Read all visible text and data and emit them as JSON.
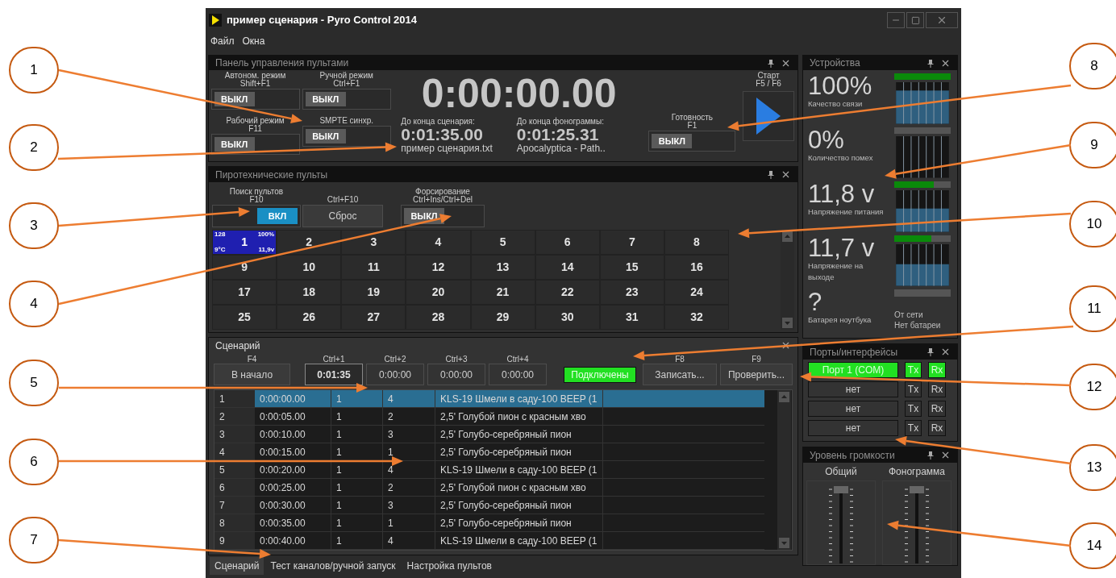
{
  "window": {
    "title": "пример сценария - Pyro Control 2014"
  },
  "menu": [
    "Файл",
    "Окна"
  ],
  "control_panel": {
    "title": "Панель управления пультами",
    "toggles": [
      {
        "label": "Автоном. режим",
        "hotkey": "Shift+F1",
        "value": "ВЫКЛ",
        "on": false
      },
      {
        "label": "Ручной режим",
        "hotkey": "Ctrl+F1",
        "value": "ВЫКЛ",
        "on": false
      },
      {
        "label": "Рабочий режим",
        "hotkey": "F11",
        "value": "ВЫКЛ",
        "on": false
      },
      {
        "label": "SMPTE синхр.",
        "value": "ВЫКЛ",
        "on": false
      }
    ],
    "main_time": "0:00:00.00",
    "remaining": [
      {
        "label": "До конца сценария:",
        "time": "0:01:35.00",
        "file": "пример сценария.txt"
      },
      {
        "label": "До конца фонограммы:",
        "time": "0:01:25.31",
        "file": "Apocalyptica - Path.."
      }
    ],
    "ready": {
      "label": "Готовность",
      "hotkey": "F1",
      "value": "ВЫКЛ",
      "on": false
    },
    "start": {
      "label": "Старт",
      "hotkey": "F5 / F6"
    }
  },
  "pyro_panel": {
    "title": "Пиротехнические пульты",
    "search": {
      "label": "Поиск пультов",
      "hotkey": "F10",
      "value": "ВКЛ",
      "on": true
    },
    "reset": {
      "hotkey": "Ctrl+F10",
      "label": "Сброс"
    },
    "force": {
      "label": "Форсирование",
      "hotkey": "Ctrl+Ins/Ctrl+Del",
      "value": "ВЫКЛ",
      "on": false
    },
    "consoles": [
      {
        "number": "1",
        "connected": true,
        "channels": "128",
        "link": "100%",
        "temperature": "9°C",
        "voltage": "11,9v"
      },
      {
        "number": "2",
        "connected": false
      },
      {
        "number": "3",
        "connected": false
      },
      {
        "number": "4",
        "connected": false
      },
      {
        "number": "5",
        "connected": false
      },
      {
        "number": "6",
        "connected": false
      },
      {
        "number": "7",
        "connected": false
      },
      {
        "number": "8",
        "connected": false
      },
      {
        "number": "9",
        "connected": false
      },
      {
        "number": "10",
        "connected": false
      },
      {
        "number": "11",
        "connected": false
      },
      {
        "number": "12",
        "connected": false
      },
      {
        "number": "13",
        "connected": false
      },
      {
        "number": "14",
        "connected": false
      },
      {
        "number": "15",
        "connected": false
      },
      {
        "number": "16",
        "connected": false
      },
      {
        "number": "17",
        "connected": false
      },
      {
        "number": "18",
        "connected": false
      },
      {
        "number": "19",
        "connected": false
      },
      {
        "number": "20",
        "connected": false
      },
      {
        "number": "21",
        "connected": false
      },
      {
        "number": "22",
        "connected": false
      },
      {
        "number": "23",
        "connected": false
      },
      {
        "number": "24",
        "connected": false
      },
      {
        "number": "25",
        "connected": false
      },
      {
        "number": "26",
        "connected": false
      },
      {
        "number": "27",
        "connected": false
      },
      {
        "number": "28",
        "connected": false
      },
      {
        "number": "29",
        "connected": false
      },
      {
        "number": "30",
        "connected": false
      },
      {
        "number": "31",
        "connected": false
      },
      {
        "number": "32",
        "connected": false
      }
    ]
  },
  "scenario": {
    "title": "Сценарий",
    "start_button": {
      "hotkey": "F4",
      "label": "В начало"
    },
    "markers": [
      {
        "hotkey": "Ctrl+1",
        "value": "0:01:35",
        "selected": true
      },
      {
        "hotkey": "Ctrl+2",
        "value": "0:00:00",
        "selected": false
      },
      {
        "hotkey": "Ctrl+3",
        "value": "0:00:00",
        "selected": false
      },
      {
        "hotkey": "Ctrl+4",
        "value": "0:00:00",
        "selected": false
      }
    ],
    "status": "Подключены",
    "record": {
      "hotkey": "F8",
      "label": "Записать..."
    },
    "check": {
      "hotkey": "F9",
      "label": "Проверить..."
    },
    "rows": [
      {
        "index": "1",
        "time": "0:00:00.00",
        "column_3": "1",
        "column_4": "4",
        "description": "KLS-19 Шмели в саду-100 BEEP (1",
        "selected": true
      },
      {
        "index": "2",
        "time": "0:00:05.00",
        "column_3": "1",
        "column_4": "2",
        "description": "2,5' Голубой пион с красным хво",
        "selected": false
      },
      {
        "index": "3",
        "time": "0:00:10.00",
        "column_3": "1",
        "column_4": "3",
        "description": "2,5' Голубо-серебряный  пион",
        "selected": false
      },
      {
        "index": "4",
        "time": "0:00:15.00",
        "column_3": "1",
        "column_4": "1",
        "description": "2,5' Голубо-серебряный  пион",
        "selected": false
      },
      {
        "index": "5",
        "time": "0:00:20.00",
        "column_3": "1",
        "column_4": "4",
        "description": "KLS-19 Шмели в саду-100 BEEP (1",
        "selected": false
      },
      {
        "index": "6",
        "time": "0:00:25.00",
        "column_3": "1",
        "column_4": "2",
        "description": "2,5' Голубой пион с красным хво",
        "selected": false
      },
      {
        "index": "7",
        "time": "0:00:30.00",
        "column_3": "1",
        "column_4": "3",
        "description": "2,5' Голубо-серебряный  пион",
        "selected": false
      },
      {
        "index": "8",
        "time": "0:00:35.00",
        "column_3": "1",
        "column_4": "1",
        "description": "2,5' Голубо-серебряный  пион",
        "selected": false
      },
      {
        "index": "9",
        "time": "0:00:40.00",
        "column_3": "1",
        "column_4": "4",
        "description": "KLS-19 Шмели в саду-100 BEEP (1",
        "selected": false
      }
    ]
  },
  "bottom_tabs": [
    {
      "label": "Сценарий",
      "selected": true
    },
    {
      "label": "Тест каналов/ручной запуск",
      "selected": false
    },
    {
      "label": "Настройка пультов",
      "selected": false
    }
  ],
  "devices": {
    "title": "Устройства",
    "metrics": [
      {
        "kind": "meter",
        "value": "100%",
        "label": "Качество связи",
        "level": 1
      },
      {
        "kind": "meter",
        "value": "0%",
        "label": "Количество помех",
        "level": 0
      },
      {
        "kind": "meter",
        "value": "11,8 v",
        "label": "Напряжение питания",
        "level": 0.7
      },
      {
        "kind": "meter",
        "value": "11,7 v",
        "label": "Напряжение на выходе",
        "level": 0.65
      },
      {
        "kind": "battery",
        "value": "?",
        "label": "Батарея ноутбука",
        "level": 0,
        "source": "От сети",
        "state": "Нет батареи"
      }
    ]
  },
  "ports": {
    "title": "Порты/интерфейсы",
    "items": [
      {
        "label": "Порт 1 (COM)",
        "tx": "Tx",
        "rx": "Rx",
        "active": true
      },
      {
        "label": "нет",
        "tx": "Tx",
        "rx": "Rx",
        "active": false
      },
      {
        "label": "нет",
        "tx": "Tx",
        "rx": "Rx",
        "active": false
      },
      {
        "label": "нет",
        "tx": "Tx",
        "rx": "Rx",
        "active": false
      }
    ]
  },
  "volume": {
    "title": "Уровень громкости",
    "sliders": [
      {
        "label": "Общий",
        "level": 1
      },
      {
        "label": "Фонограмма",
        "level": 1
      }
    ]
  },
  "callouts": [
    {
      "number": "1"
    },
    {
      "number": "2"
    },
    {
      "number": "3"
    },
    {
      "number": "4"
    },
    {
      "number": "5"
    },
    {
      "number": "6"
    },
    {
      "number": "7"
    },
    {
      "number": "8"
    },
    {
      "number": "9"
    },
    {
      "number": "10"
    },
    {
      "number": "11"
    },
    {
      "number": "12"
    },
    {
      "number": "13"
    },
    {
      "number": "14"
    }
  ]
}
